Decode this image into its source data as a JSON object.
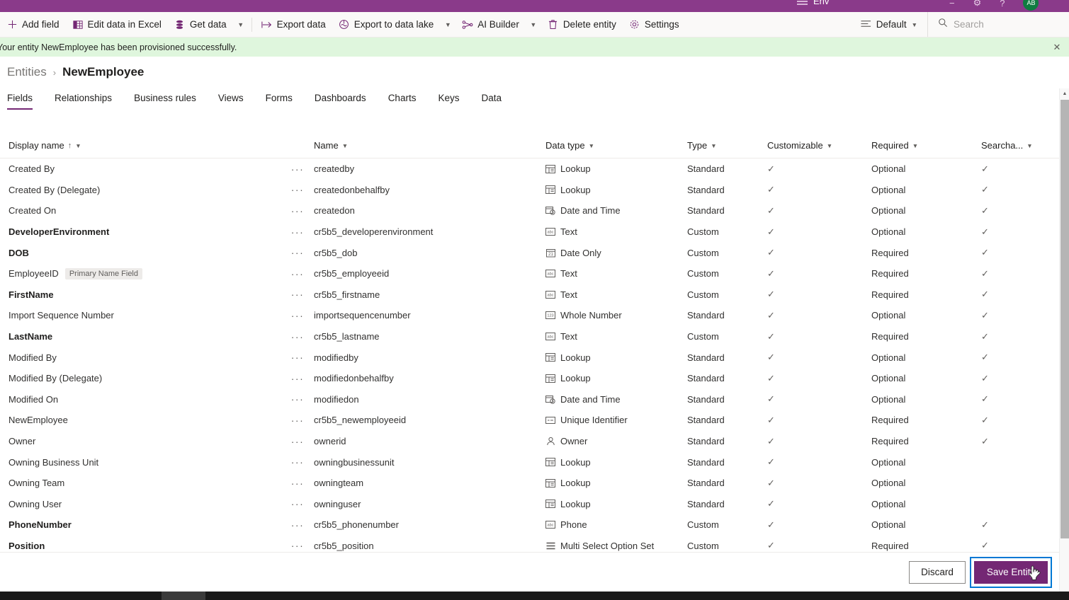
{
  "appbar": {
    "env_label": "Env",
    "avatar_initials": "AB"
  },
  "commandbar": {
    "buttons": [
      {
        "label": "Add field",
        "icon": "plus-icon",
        "has_chevron": false
      },
      {
        "label": "Edit data in Excel",
        "icon": "excel-icon",
        "has_chevron": false
      },
      {
        "label": "Get data",
        "icon": "database-icon",
        "has_chevron": true
      },
      {
        "label": "Export data",
        "icon": "export-icon",
        "has_chevron": false
      },
      {
        "label": "Export to data lake",
        "icon": "datalake-icon",
        "has_chevron": true
      },
      {
        "label": "AI Builder",
        "icon": "ai-builder-icon",
        "has_chevron": true
      },
      {
        "label": "Delete entity",
        "icon": "trash-icon",
        "has_chevron": false
      },
      {
        "label": "Settings",
        "icon": "gear-icon",
        "has_chevron": false
      }
    ],
    "view_selector": "Default",
    "search_placeholder": "Search"
  },
  "banner": {
    "message": "Your entity NewEmployee has been provisioned successfully.",
    "close_label": "✕",
    "background_color": "#dff6dd"
  },
  "breadcrumb": {
    "parent": "Entities",
    "separator": "›",
    "current": "NewEmployee"
  },
  "tabs": [
    {
      "label": "Fields",
      "active": true
    },
    {
      "label": "Relationships",
      "active": false
    },
    {
      "label": "Business rules",
      "active": false
    },
    {
      "label": "Views",
      "active": false
    },
    {
      "label": "Forms",
      "active": false
    },
    {
      "label": "Dashboards",
      "active": false
    },
    {
      "label": "Charts",
      "active": false
    },
    {
      "label": "Keys",
      "active": false
    },
    {
      "label": "Data",
      "active": false
    }
  ],
  "grid": {
    "columns": [
      {
        "label": "Display name",
        "sorted": true,
        "sort_glyph": "↑"
      },
      {
        "label": "Name",
        "sorted": false
      },
      {
        "label": "Data type",
        "sorted": false
      },
      {
        "label": "Type",
        "sorted": false
      },
      {
        "label": "Customizable",
        "sorted": false
      },
      {
        "label": "Required",
        "sorted": false
      },
      {
        "label": "Searcha...",
        "sorted": false
      }
    ],
    "ellipsis_glyph": "···",
    "check_glyph": "✓",
    "primary_name_badge": "Primary Name Field",
    "rows": [
      {
        "display_name": "Created By",
        "custom_name": false,
        "badge": null,
        "name": "createdby",
        "data_type": "Lookup",
        "data_type_icon": "lookup-icon",
        "type": "Standard",
        "customizable": true,
        "required": "Optional",
        "searchable": true
      },
      {
        "display_name": "Created By (Delegate)",
        "custom_name": false,
        "badge": null,
        "name": "createdonbehalfby",
        "data_type": "Lookup",
        "data_type_icon": "lookup-icon",
        "type": "Standard",
        "customizable": true,
        "required": "Optional",
        "searchable": true
      },
      {
        "display_name": "Created On",
        "custom_name": false,
        "badge": null,
        "name": "createdon",
        "data_type": "Date and Time",
        "data_type_icon": "date-time-icon",
        "type": "Standard",
        "customizable": true,
        "required": "Optional",
        "searchable": true
      },
      {
        "display_name": "DeveloperEnvironment",
        "custom_name": true,
        "badge": null,
        "name": "cr5b5_developerenvironment",
        "data_type": "Text",
        "data_type_icon": "text-icon",
        "type": "Custom",
        "customizable": true,
        "required": "Optional",
        "searchable": true
      },
      {
        "display_name": "DOB",
        "custom_name": true,
        "badge": null,
        "name": "cr5b5_dob",
        "data_type": "Date Only",
        "data_type_icon": "date-only-icon",
        "type": "Custom",
        "customizable": true,
        "required": "Required",
        "searchable": true
      },
      {
        "display_name": "EmployeeID",
        "custom_name": false,
        "badge": "Primary Name Field",
        "name": "cr5b5_employeeid",
        "data_type": "Text",
        "data_type_icon": "text-icon",
        "type": "Custom",
        "customizable": true,
        "required": "Required",
        "searchable": true
      },
      {
        "display_name": "FirstName",
        "custom_name": true,
        "badge": null,
        "name": "cr5b5_firstname",
        "data_type": "Text",
        "data_type_icon": "text-icon",
        "type": "Custom",
        "customizable": true,
        "required": "Required",
        "searchable": true
      },
      {
        "display_name": "Import Sequence Number",
        "custom_name": false,
        "badge": null,
        "name": "importsequencenumber",
        "data_type": "Whole Number",
        "data_type_icon": "whole-number-icon",
        "type": "Standard",
        "customizable": true,
        "required": "Optional",
        "searchable": true
      },
      {
        "display_name": "LastName",
        "custom_name": true,
        "badge": null,
        "name": "cr5b5_lastname",
        "data_type": "Text",
        "data_type_icon": "text-icon",
        "type": "Custom",
        "customizable": true,
        "required": "Required",
        "searchable": true
      },
      {
        "display_name": "Modified By",
        "custom_name": false,
        "badge": null,
        "name": "modifiedby",
        "data_type": "Lookup",
        "data_type_icon": "lookup-icon",
        "type": "Standard",
        "customizable": true,
        "required": "Optional",
        "searchable": true
      },
      {
        "display_name": "Modified By (Delegate)",
        "custom_name": false,
        "badge": null,
        "name": "modifiedonbehalfby",
        "data_type": "Lookup",
        "data_type_icon": "lookup-icon",
        "type": "Standard",
        "customizable": true,
        "required": "Optional",
        "searchable": true
      },
      {
        "display_name": "Modified On",
        "custom_name": false,
        "badge": null,
        "name": "modifiedon",
        "data_type": "Date and Time",
        "data_type_icon": "date-time-icon",
        "type": "Standard",
        "customizable": true,
        "required": "Optional",
        "searchable": true
      },
      {
        "display_name": "NewEmployee",
        "custom_name": false,
        "badge": null,
        "name": "cr5b5_newemployeeid",
        "data_type": "Unique Identifier",
        "data_type_icon": "unique-identifier-icon",
        "type": "Standard",
        "customizable": true,
        "required": "Required",
        "searchable": true
      },
      {
        "display_name": "Owner",
        "custom_name": false,
        "badge": null,
        "name": "ownerid",
        "data_type": "Owner",
        "data_type_icon": "owner-icon",
        "type": "Standard",
        "customizable": true,
        "required": "Required",
        "searchable": true
      },
      {
        "display_name": "Owning Business Unit",
        "custom_name": false,
        "badge": null,
        "name": "owningbusinessunit",
        "data_type": "Lookup",
        "data_type_icon": "lookup-icon",
        "type": "Standard",
        "customizable": true,
        "required": "Optional",
        "searchable": false
      },
      {
        "display_name": "Owning Team",
        "custom_name": false,
        "badge": null,
        "name": "owningteam",
        "data_type": "Lookup",
        "data_type_icon": "lookup-icon",
        "type": "Standard",
        "customizable": true,
        "required": "Optional",
        "searchable": false
      },
      {
        "display_name": "Owning User",
        "custom_name": false,
        "badge": null,
        "name": "owninguser",
        "data_type": "Lookup",
        "data_type_icon": "lookup-icon",
        "type": "Standard",
        "customizable": true,
        "required": "Optional",
        "searchable": false
      },
      {
        "display_name": "PhoneNumber",
        "custom_name": true,
        "badge": null,
        "name": "cr5b5_phonenumber",
        "data_type": "Phone",
        "data_type_icon": "phone-icon",
        "type": "Custom",
        "customizable": true,
        "required": "Optional",
        "searchable": true
      },
      {
        "display_name": "Position",
        "custom_name": true,
        "badge": null,
        "name": "cr5b5_position",
        "data_type": "Multi Select Option Set",
        "data_type_icon": "multi-select-icon",
        "type": "Custom",
        "customizable": true,
        "required": "Required",
        "searchable": true
      }
    ]
  },
  "footer": {
    "discard_label": "Discard",
    "save_label": "Save Entity",
    "save_color": "#742774",
    "focus_ring_color": "#0078d4"
  }
}
